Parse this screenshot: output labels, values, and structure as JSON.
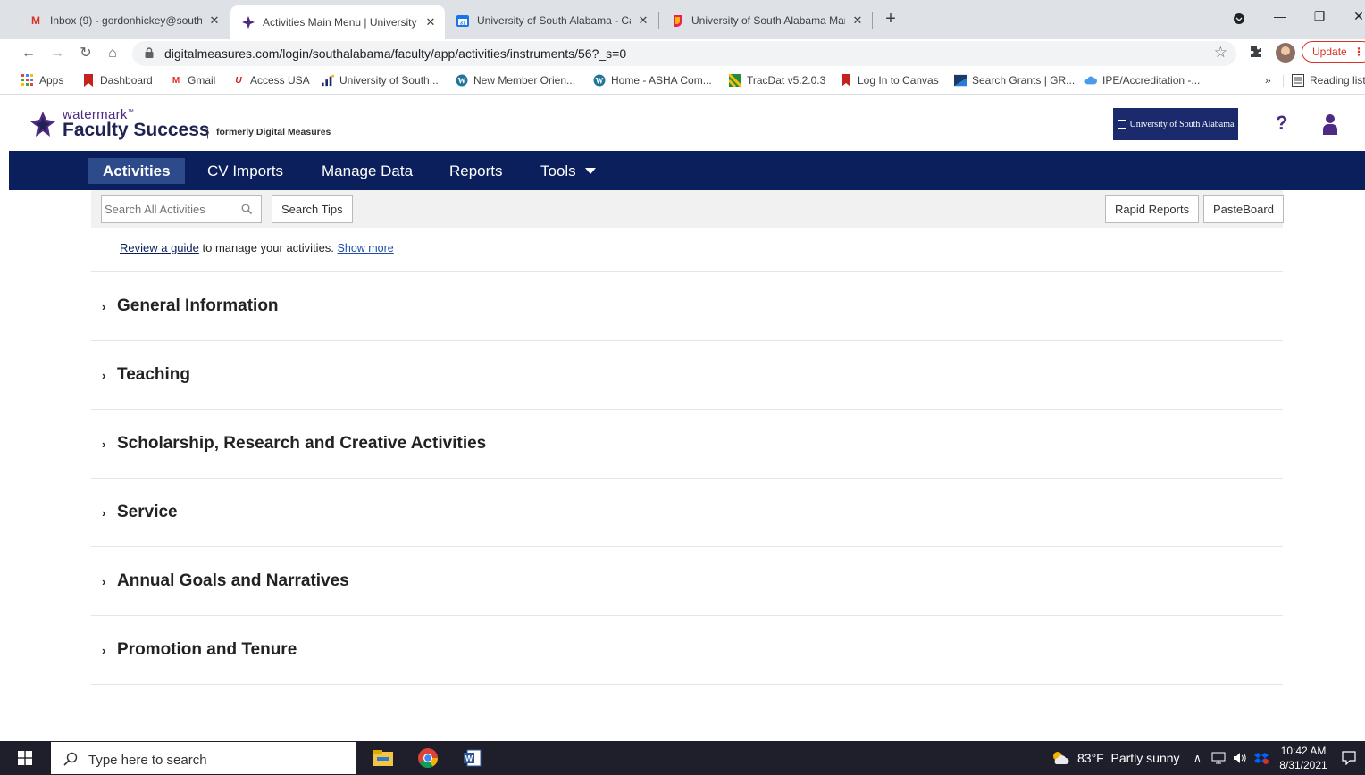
{
  "browser": {
    "tabs": [
      {
        "title": "Inbox (9) - gordonhickey@south",
        "icon": "gmail-icon"
      },
      {
        "title": "Activities Main Menu | University",
        "icon": "watermark-icon"
      },
      {
        "title": "University of South Alabama - Ca",
        "icon": "calendar-icon"
      },
      {
        "title": "University of South Alabama Mar",
        "icon": "pendo-icon"
      }
    ],
    "new_tab": "+",
    "url": "digitalmeasures.com/login/southalabama/faculty/app/activities/instruments/56?_s=0",
    "update_label": "Update",
    "bookmarks": [
      {
        "label": "Apps"
      },
      {
        "label": "Dashboard"
      },
      {
        "label": "Gmail"
      },
      {
        "label": "Access USA"
      },
      {
        "label": "University of South..."
      },
      {
        "label": "New Member Orien..."
      },
      {
        "label": "Home - ASHA Com..."
      },
      {
        "label": "TracDat v5.2.0.3"
      },
      {
        "label": "Log In to Canvas"
      },
      {
        "label": "Search Grants | GR..."
      },
      {
        "label": "IPE/Accreditation -..."
      }
    ],
    "bookmarks_more": "»",
    "reading_list": "Reading list"
  },
  "app": {
    "logo_small": "watermark",
    "logo_tm": "™",
    "logo_big": "Faculty Success",
    "logo_sep": "|",
    "logo_formerly": "formerly Digital Measures",
    "university_badge": "University of South Alabama",
    "help": "?",
    "nav": [
      {
        "label": "Activities"
      },
      {
        "label": "CV Imports"
      },
      {
        "label": "Manage Data"
      },
      {
        "label": "Reports"
      },
      {
        "label": "Tools"
      }
    ],
    "search_placeholder": "Search All Activities",
    "search_tips": "Search Tips",
    "rapid_reports": "Rapid Reports",
    "pasteboard": "PasteBoard",
    "guide_link": "Review a guide",
    "guide_text": " to manage your activities. ",
    "guide_more": "Show more",
    "sections": [
      {
        "title": "General Information"
      },
      {
        "title": "Teaching"
      },
      {
        "title": "Scholarship, Research and Creative Activities"
      },
      {
        "title": "Service"
      },
      {
        "title": "Annual Goals and Narratives"
      },
      {
        "title": "Promotion and Tenure"
      }
    ],
    "chevron": "›"
  },
  "taskbar": {
    "search_placeholder": "Type here to search",
    "weather": "83°F  Partly sunny",
    "time": "10:42 AM",
    "date": "8/31/2021"
  },
  "colors": {
    "nav_bg": "#0b1f5c",
    "nav_active": "#2d4a8a",
    "brand_purple": "#4e2a84"
  }
}
